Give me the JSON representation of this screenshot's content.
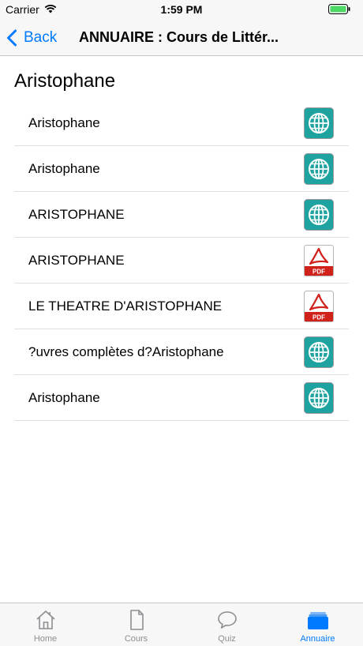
{
  "status_bar": {
    "carrier": "Carrier",
    "time": "1:59 PM",
    "wifi_icon": "wifi-icon",
    "battery_icon": "battery-icon"
  },
  "nav": {
    "back_label": "Back",
    "title": "ANNUAIRE : Cours de Littér..."
  },
  "section": {
    "title": "Aristophane"
  },
  "items": [
    {
      "label": "Aristophane",
      "icon": "globe-icon"
    },
    {
      "label": "Aristophane",
      "icon": "globe-icon"
    },
    {
      "label": "ARISTOPHANE",
      "icon": "globe-icon"
    },
    {
      "label": "ARISTOPHANE",
      "icon": "pdf-icon",
      "icon_text": "PDF"
    },
    {
      "label": "LE THEATRE D'ARISTOPHANE",
      "icon": "pdf-icon",
      "icon_text": "PDF"
    },
    {
      "label": "?uvres complètes d?Aristophane",
      "icon": "globe-icon"
    },
    {
      "label": "Aristophane",
      "icon": "globe-icon"
    }
  ],
  "tabs": [
    {
      "label": "Home",
      "icon": "house-icon",
      "active": false
    },
    {
      "label": "Cours",
      "icon": "document-icon",
      "active": false
    },
    {
      "label": "Quiz",
      "icon": "chat-bubble-icon",
      "active": false
    },
    {
      "label": "Annuaire",
      "icon": "folder-icon",
      "active": true
    }
  ],
  "colors": {
    "accent": "#007aff",
    "globe_bg": "#1fa3a0",
    "pdf_red": "#d0211b",
    "tab_inactive": "#8e8e93"
  }
}
